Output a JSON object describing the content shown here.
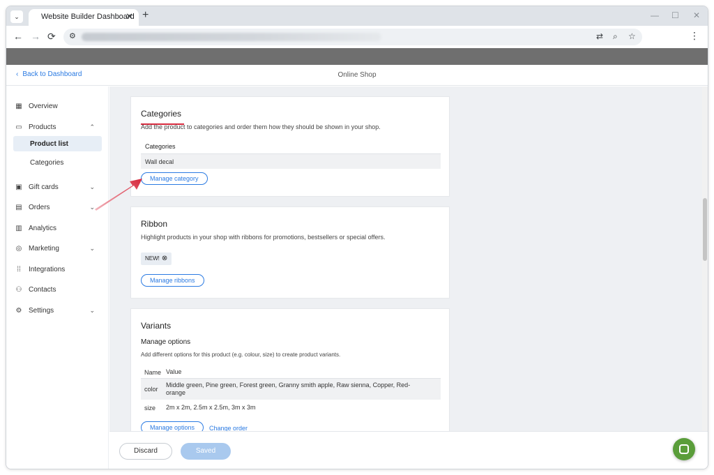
{
  "browser": {
    "tab_title": "Website Builder Dashboard",
    "tab_close": "✕",
    "new_tab": "+",
    "tab_menu": "⌄",
    "window_controls": [
      "—",
      "☐",
      "✕"
    ],
    "nav": {
      "back": "←",
      "forward": "→",
      "reload": "⟳"
    },
    "omnibox_icons": {
      "site_info": "⚙",
      "translate": "⇄",
      "zoom": "⌕",
      "bookmark": "☆",
      "menu": "⋮"
    }
  },
  "app_header": {
    "back_label": "Back to Dashboard",
    "back_chevron": "‹",
    "title": "Online Shop"
  },
  "sidebar": {
    "items": [
      {
        "label": "Overview",
        "icon": "grid-icon",
        "glyph": "▦"
      },
      {
        "label": "Products",
        "icon": "box-icon",
        "glyph": "▭",
        "chevron": "⌃"
      },
      {
        "label": "Gift cards",
        "icon": "gift-icon",
        "glyph": "▣",
        "chevron": "⌄"
      },
      {
        "label": "Orders",
        "icon": "list-icon",
        "glyph": "▤",
        "chevron": "⌄"
      },
      {
        "label": "Analytics",
        "icon": "bar-chart-icon",
        "glyph": "▥"
      },
      {
        "label": "Marketing",
        "icon": "target-icon",
        "glyph": "◎",
        "chevron": "⌄"
      },
      {
        "label": "Integrations",
        "icon": "dots-grid-icon",
        "glyph": "⁞⁞"
      },
      {
        "label": "Contacts",
        "icon": "people-icon",
        "glyph": "⚇"
      },
      {
        "label": "Settings",
        "icon": "gear-icon",
        "glyph": "⚙",
        "chevron": "⌄"
      }
    ],
    "sub_items": [
      {
        "label": "Product list",
        "active": true
      },
      {
        "label": "Categories",
        "active": false
      }
    ]
  },
  "categories_card": {
    "title": "Categories",
    "description": "Add the product to categories and order them how they should be shown in your shop.",
    "table_header": "Categories",
    "rows": [
      "Wall decal"
    ],
    "button": "Manage category"
  },
  "ribbon_card": {
    "title": "Ribbon",
    "description": "Highlight products in your shop with ribbons for promotions, bestsellers or special offers.",
    "badge": "NEW!",
    "badge_remove": "⊗",
    "button": "Manage ribbons"
  },
  "variants_card": {
    "title": "Variants",
    "subtitle": "Manage options",
    "description": "Add different options for this product (e.g. colour, size) to create product variants.",
    "columns": [
      "Name",
      "Value"
    ],
    "rows": [
      {
        "name": "color",
        "value": "Middle green, Pine green, Forest green, Granny smith apple, Raw sienna, Copper, Red-orange"
      },
      {
        "name": "size",
        "value": "2m x 2m, 2.5m x 2.5m, 3m x 3m"
      }
    ],
    "manage_button": "Manage options",
    "change_order": "Change order"
  },
  "footer": {
    "discard": "Discard",
    "saved": "Saved"
  },
  "colors": {
    "accent": "#2a7ae2",
    "annotation_red": "#d6283c",
    "chat_green": "#5a9d3a",
    "saved_disabled": "#a9c9ee"
  }
}
